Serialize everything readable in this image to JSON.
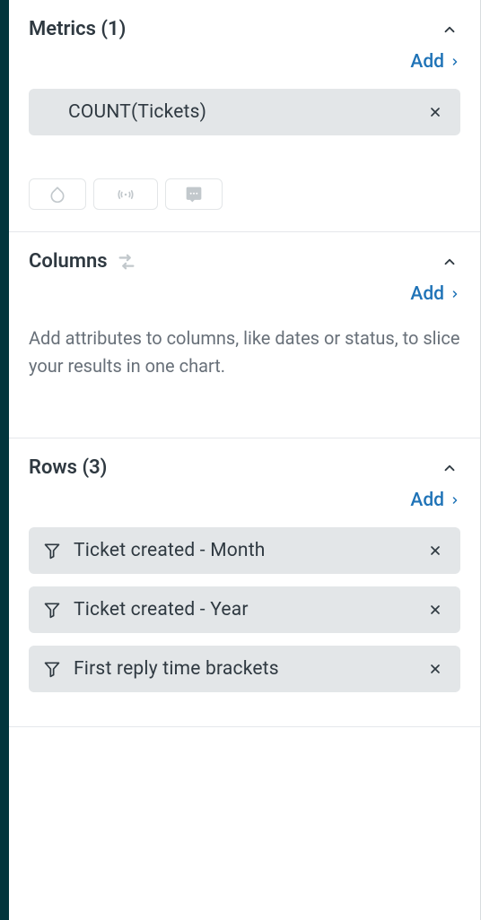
{
  "metrics": {
    "title": "Metrics (1)",
    "add_label": "Add",
    "items": [
      {
        "label": "COUNT(Tickets)"
      }
    ]
  },
  "columns": {
    "title": "Columns",
    "add_label": "Add",
    "helper": "Add attributes to columns, like dates or status, to slice your results in one chart."
  },
  "rows": {
    "title": "Rows (3)",
    "add_label": "Add",
    "items": [
      {
        "label": "Ticket created - Month"
      },
      {
        "label": "Ticket created - Year"
      },
      {
        "label": "First reply time brackets"
      }
    ]
  }
}
